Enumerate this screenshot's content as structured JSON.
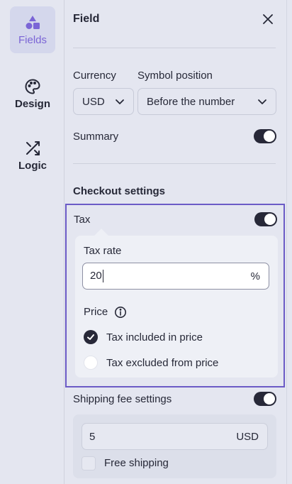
{
  "sidebar": {
    "items": [
      {
        "label": "Fields",
        "icon": "shapes-icon",
        "active": true
      },
      {
        "label": "Design",
        "icon": "palette-icon",
        "active": false
      },
      {
        "label": "Logic",
        "icon": "shuffle-icon",
        "active": false
      }
    ]
  },
  "panel": {
    "title": "Field",
    "currency": {
      "label": "Currency",
      "value": "USD"
    },
    "symbol_position": {
      "label": "Symbol position",
      "value": "Before the number"
    },
    "summary": {
      "label": "Summary",
      "enabled": true
    },
    "checkout_heading": "Checkout settings",
    "tax": {
      "label": "Tax",
      "enabled": true,
      "rate_label": "Tax rate",
      "rate_value": "20",
      "rate_unit": "%",
      "price_label": "Price",
      "options": [
        {
          "label": "Tax included in price",
          "selected": true
        },
        {
          "label": "Tax excluded from price",
          "selected": false
        }
      ]
    },
    "shipping": {
      "label": "Shipping fee settings",
      "enabled": true,
      "fee_value": "5",
      "fee_unit": "USD",
      "free_shipping_label": "Free shipping",
      "free_shipping_checked": false
    }
  },
  "colors": {
    "accent": "#7b65d6",
    "highlight_border": "#6b5bc6",
    "toggle_on": "#272838",
    "background": "#e4e6f0"
  }
}
